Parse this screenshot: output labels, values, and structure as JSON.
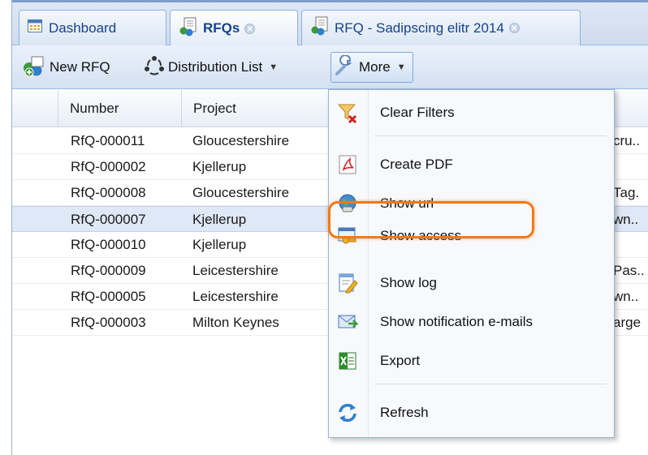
{
  "tabs": [
    {
      "label": "Dashboard",
      "icon": "dashboard-icon",
      "closable": false,
      "active": false
    },
    {
      "label": "RFQs",
      "icon": "rfq-icon",
      "closable": true,
      "active": true
    },
    {
      "label": "RFQ - Sadipscing elitr 2014",
      "icon": "rfq-icon",
      "closable": true,
      "active": false
    }
  ],
  "toolbar": {
    "new_rfq_label": "New RFQ",
    "distribution_list_label": "Distribution List",
    "more_label": "More"
  },
  "grid": {
    "columns": [
      "Number",
      "Project"
    ],
    "rows": [
      {
        "number": "RfQ-000011",
        "project": "Gloucestershire",
        "extra": "cru.."
      },
      {
        "number": "RfQ-000002",
        "project": "Kjellerup",
        "extra": ""
      },
      {
        "number": "RfQ-000008",
        "project": "Gloucestershire",
        "extra": "Tag."
      },
      {
        "number": "RfQ-000007",
        "project": "Kjellerup",
        "extra": "wn.."
      },
      {
        "number": "RfQ-000010",
        "project": "Kjellerup",
        "extra": ""
      },
      {
        "number": "RfQ-000009",
        "project": "Leicestershire",
        "extra": "Pas.."
      },
      {
        "number": "RfQ-000005",
        "project": "Leicestershire",
        "extra": "wn.."
      },
      {
        "number": "RfQ-000003",
        "project": "Milton Keynes",
        "extra": "arge"
      }
    ],
    "selected_row": 3
  },
  "menu": {
    "items": [
      {
        "label": "Clear Filters",
        "icon": "clear-filters-icon"
      },
      {
        "label": "Create PDF",
        "icon": "pdf-icon"
      },
      {
        "label": "Show url",
        "icon": "url-icon"
      },
      {
        "label": "Show access",
        "icon": "access-key-icon"
      },
      {
        "label": "Show log",
        "icon": "log-icon"
      },
      {
        "label": "Show notification e-mails",
        "icon": "email-icon"
      },
      {
        "label": "Export",
        "icon": "excel-export-icon"
      },
      {
        "label": "Refresh",
        "icon": "refresh-icon"
      }
    ],
    "highlighted_item": "Show access"
  },
  "colors": {
    "tab_text": "#15428b",
    "highlight_ring": "#ef7a1a",
    "selected_row": "#dfe8f6"
  }
}
